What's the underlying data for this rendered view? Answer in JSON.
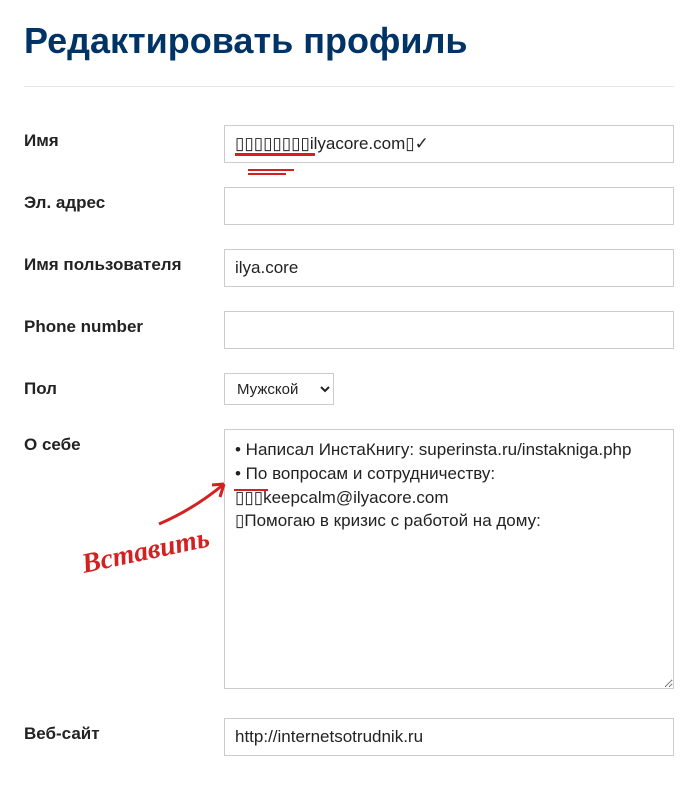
{
  "page": {
    "title": "Редактировать профиль"
  },
  "form": {
    "name": {
      "label": "Имя",
      "value": "▯▯▯▯▯▯▯▯ilyacore.com▯✓"
    },
    "email": {
      "label": "Эл. адрес",
      "value": ""
    },
    "username": {
      "label": "Имя пользователя",
      "value": "ilya.core"
    },
    "phone": {
      "label": "Phone number",
      "value": ""
    },
    "gender": {
      "label": "Пол",
      "value": "Мужской"
    },
    "about": {
      "label": "О себе",
      "value": "• Написал ИнстаКнигу: superinsta.ru/instakniga.php\n• По вопросам и сотрудничеству:\n▯▯▯keepcalm@ilyacore.com\n▯Помогаю в кризис с работой на дому:"
    },
    "website": {
      "label": "Веб-сайт",
      "value": "http://internetsotrudnik.ru"
    }
  },
  "annotation": {
    "text": "Вставить"
  }
}
